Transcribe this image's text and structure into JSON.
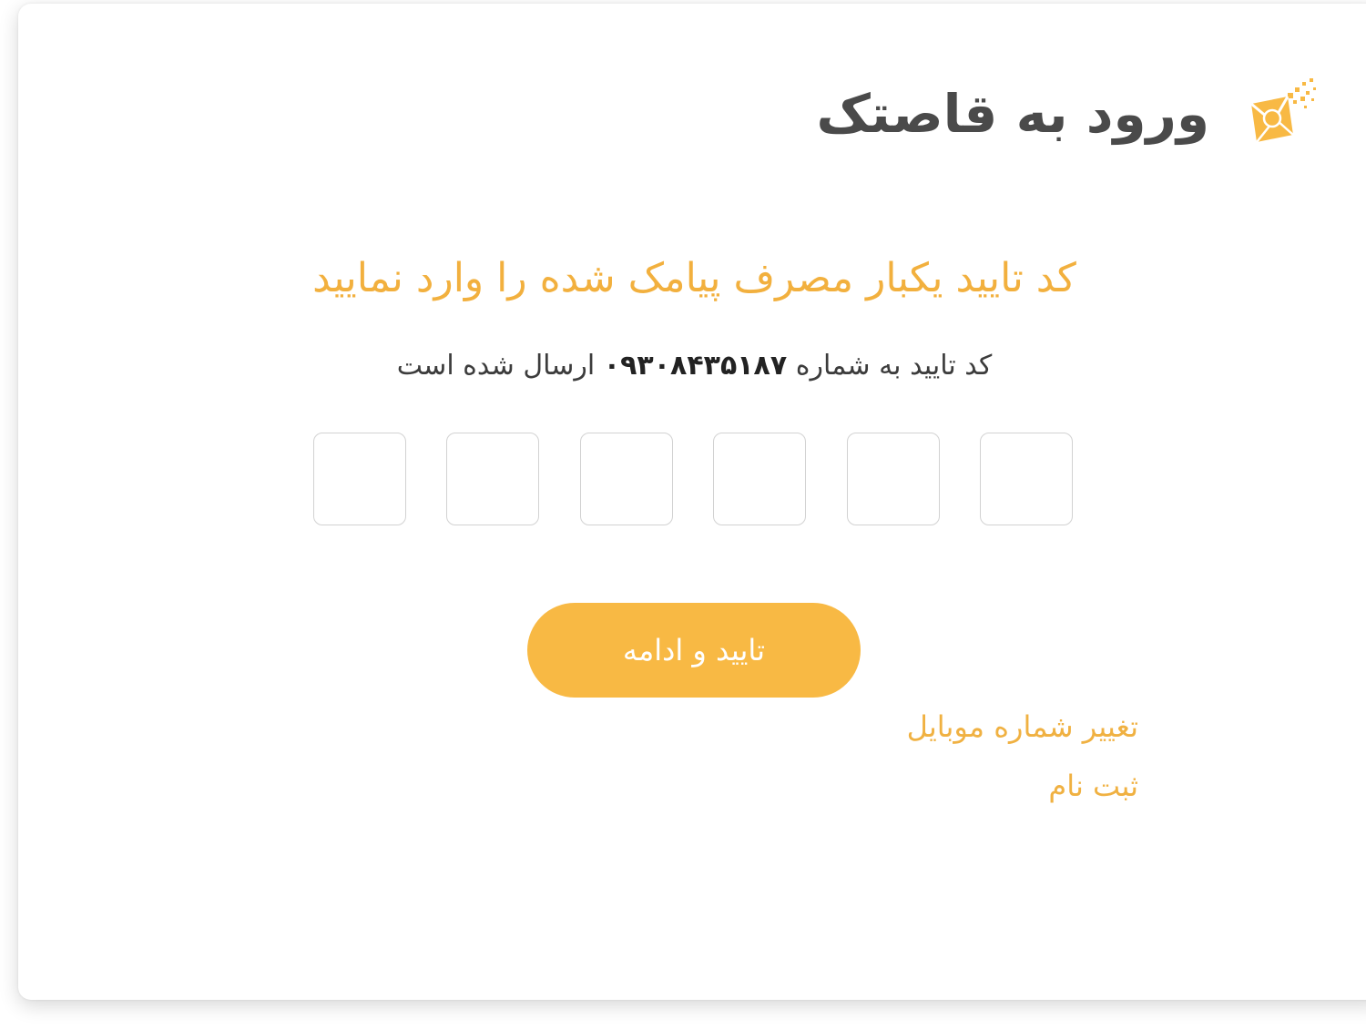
{
  "header": {
    "title": "ورود به قاصتک",
    "logo_icon": "ghasedak-logo-icon",
    "logo_color": "#f8b944"
  },
  "main": {
    "headline": "کد تایید یکبار مصرف پیامک شده را وارد نمایید",
    "subline_before": "کد تایید به شماره",
    "phone": "۰۹۳۰۸۴۳۵۱۸۷",
    "subline_after": "ارسال شده است",
    "otp_boxes": [
      "",
      "",
      "",
      "",
      "",
      ""
    ],
    "submit_label": "تایید و ادامه",
    "change_mobile_label": "تغییر شماره موبایل",
    "register_label": "ثبت نام"
  },
  "colors": {
    "accent": "#f8b944",
    "headline": "#f2b03e",
    "title": "#4a4a4a"
  }
}
